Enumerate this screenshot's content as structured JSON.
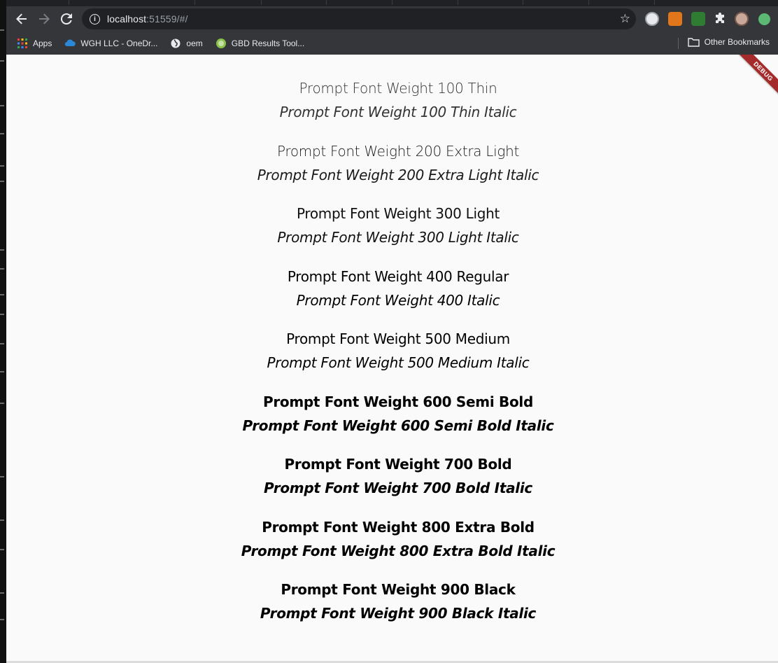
{
  "browser": {
    "url_host": "localhost",
    "url_rest": ":51559/#/",
    "bookmarks": [
      {
        "label": "Apps",
        "icon": "apps-grid-icon"
      },
      {
        "label": "WGH LLC - OneDr...",
        "icon": "onedrive-cloud-icon"
      },
      {
        "label": "oem",
        "icon": "globe-icon"
      },
      {
        "label": "GBD Results Tool...",
        "icon": "gbd-logo-icon"
      }
    ],
    "other_bookmarks": "Other Bookmarks"
  },
  "app": {
    "debug_banner": "DEBUG",
    "samples": [
      {
        "regular": "Prompt Font Weight 100 Thin",
        "italic": "Prompt Font Weight 100 Thin Italic"
      },
      {
        "regular": "Prompt Font Weight 200 Extra Light",
        "italic": "Prompt Font Weight 200 Extra Light Italic"
      },
      {
        "regular": "Prompt Font Weight 300 Light",
        "italic": "Prompt Font Weight 300 Light Italic"
      },
      {
        "regular": "Prompt Font Weight 400 Regular",
        "italic": "Prompt Font Weight 400 Italic"
      },
      {
        "regular": "Prompt Font Weight 500 Medium",
        "italic": "Prompt Font Weight 500 Medium Italic"
      },
      {
        "regular": "Prompt Font Weight 600 Semi Bold",
        "italic": "Prompt Font Weight 600 Semi Bold Italic"
      },
      {
        "regular": "Prompt Font Weight 700 Bold",
        "italic": "Prompt Font Weight 700 Bold Italic"
      },
      {
        "regular": "Prompt Font Weight 800 Extra Bold",
        "italic": "Prompt Font Weight 800 Extra Bold Italic"
      },
      {
        "regular": "Prompt Font Weight 900 Black",
        "italic": "Prompt Font Weight 900 Black Italic"
      }
    ]
  },
  "colors": {
    "toolbar": "#35363a",
    "omnibox": "#202124",
    "page_background": "#fafafa",
    "debug_banner": "#a52a2a"
  }
}
